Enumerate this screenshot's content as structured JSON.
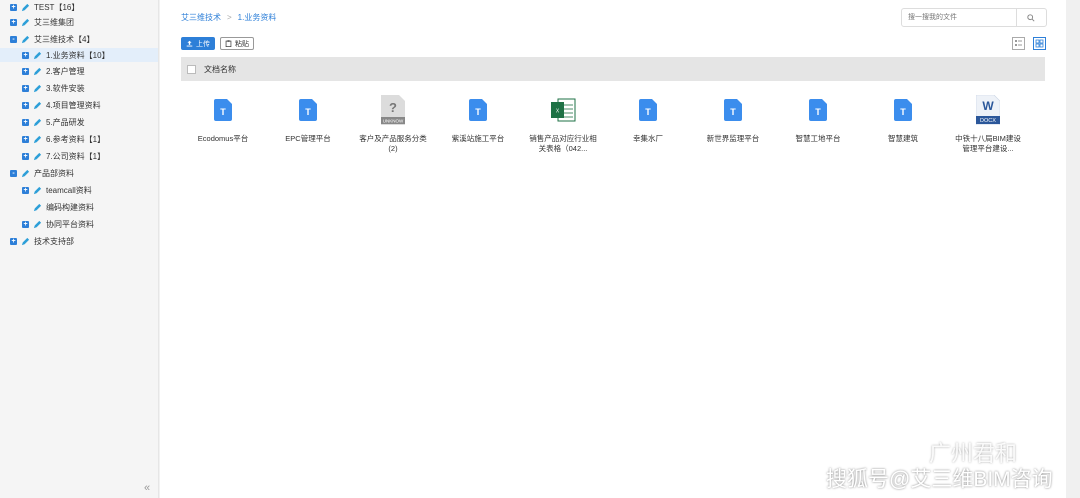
{
  "sidebar": {
    "items": [
      {
        "label": "TEST【16】",
        "toggle": "+"
      },
      {
        "label": "艾三维集团",
        "toggle": "+"
      },
      {
        "label": "艾三维技术【4】",
        "toggle": "-"
      },
      {
        "label": "1.业务资料【10】",
        "toggle": "+",
        "selected": true
      },
      {
        "label": "2.客户管理",
        "toggle": "+"
      },
      {
        "label": "3.软件安装",
        "toggle": "+"
      },
      {
        "label": "4.项目管理资料",
        "toggle": "+"
      },
      {
        "label": "5.产品研发",
        "toggle": "+"
      },
      {
        "label": "6.参考资料【1】",
        "toggle": "+"
      },
      {
        "label": "7.公司资料【1】",
        "toggle": "+"
      },
      {
        "label": "产品部资料",
        "toggle": "-"
      },
      {
        "label": "teamcall资料",
        "toggle": "+"
      },
      {
        "label": "编码构建资料",
        "toggle": ""
      },
      {
        "label": "协同平台资料",
        "toggle": "+"
      },
      {
        "label": "技术支持部",
        "toggle": "+"
      }
    ],
    "collapse_glyph": "«"
  },
  "breadcrumb": {
    "root": "艾三维技术",
    "sep": ">",
    "current": "1.业务资料"
  },
  "search": {
    "placeholder": "搜一搜我的文件"
  },
  "toolbar": {
    "upload_label": "上传",
    "paste_label": "粘贴"
  },
  "table": {
    "header": "文档名称"
  },
  "files": [
    {
      "name": "Ecodomus平台",
      "icon": "doc-t-icon"
    },
    {
      "name": "EPC管理平台",
      "icon": "doc-t-icon"
    },
    {
      "name": "客户及产品服务分类 (2)",
      "icon": "unknown-icon",
      "badge": "UNKNOW"
    },
    {
      "name": "紫溪站施工平台",
      "icon": "doc-t-icon"
    },
    {
      "name": "销售产品对应行业相关表格（042...",
      "icon": "excel-icon"
    },
    {
      "name": "幸集水厂",
      "icon": "doc-t-icon"
    },
    {
      "name": "新世界监理平台",
      "icon": "doc-t-icon"
    },
    {
      "name": "智慧工地平台",
      "icon": "doc-t-icon"
    },
    {
      "name": "智慧建筑",
      "icon": "doc-t-icon"
    },
    {
      "name": "中铁十八局BIM建设管理平台建设...",
      "icon": "word-icon",
      "badge": "DOCX"
    }
  ],
  "watermark": {
    "line1": "广州君和",
    "line2": "搜狐号@艾三维BIM咨询"
  },
  "colors": {
    "accent": "#2d7fd8",
    "pencil": "#2d9fd8",
    "excel": "#1e7145",
    "word": "#2b579a"
  }
}
